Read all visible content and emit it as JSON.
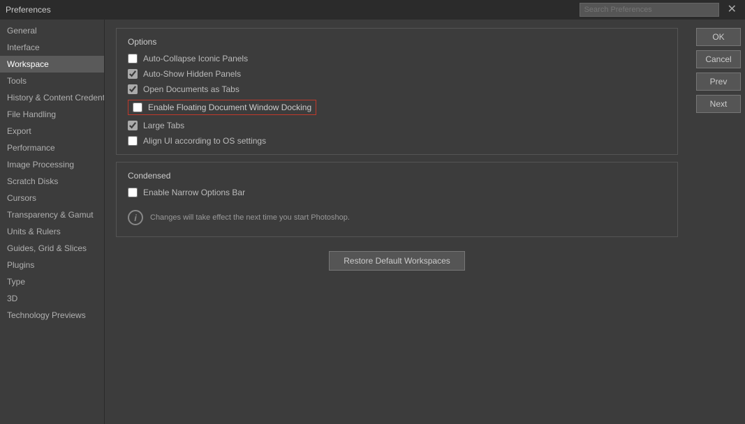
{
  "dialog": {
    "title": "Preferences"
  },
  "search": {
    "placeholder": "Search Preferences"
  },
  "sidebar": {
    "items": [
      {
        "id": "general",
        "label": "General",
        "active": false
      },
      {
        "id": "interface",
        "label": "Interface",
        "active": false
      },
      {
        "id": "workspace",
        "label": "Workspace",
        "active": true
      },
      {
        "id": "tools",
        "label": "Tools",
        "active": false
      },
      {
        "id": "history",
        "label": "History & Content Credentials",
        "active": false
      },
      {
        "id": "file-handling",
        "label": "File Handling",
        "active": false
      },
      {
        "id": "export",
        "label": "Export",
        "active": false
      },
      {
        "id": "performance",
        "label": "Performance",
        "active": false
      },
      {
        "id": "image-processing",
        "label": "Image Processing",
        "active": false
      },
      {
        "id": "scratch-disks",
        "label": "Scratch Disks",
        "active": false
      },
      {
        "id": "cursors",
        "label": "Cursors",
        "active": false
      },
      {
        "id": "transparency",
        "label": "Transparency & Gamut",
        "active": false
      },
      {
        "id": "units-rulers",
        "label": "Units & Rulers",
        "active": false
      },
      {
        "id": "guides",
        "label": "Guides, Grid & Slices",
        "active": false
      },
      {
        "id": "plugins",
        "label": "Plugins",
        "active": false
      },
      {
        "id": "type",
        "label": "Type",
        "active": false
      },
      {
        "id": "3d",
        "label": "3D",
        "active": false
      },
      {
        "id": "tech-previews",
        "label": "Technology Previews",
        "active": false
      }
    ]
  },
  "sections": {
    "options": {
      "title": "Options",
      "items": [
        {
          "id": "auto-collapse",
          "label": "Auto-Collapse Iconic Panels",
          "checked": false,
          "highlighted": false
        },
        {
          "id": "auto-show",
          "label": "Auto-Show Hidden Panels",
          "checked": true,
          "highlighted": false
        },
        {
          "id": "open-docs-tabs",
          "label": "Open Documents as Tabs",
          "checked": true,
          "highlighted": false
        },
        {
          "id": "floating-dock",
          "label": "Enable Floating Document Window Docking",
          "checked": false,
          "highlighted": true
        },
        {
          "id": "large-tabs",
          "label": "Large Tabs",
          "checked": true,
          "highlighted": false
        },
        {
          "id": "align-ui",
          "label": "Align UI according to OS settings",
          "checked": false,
          "highlighted": false
        }
      ]
    },
    "condensed": {
      "title": "Condensed",
      "items": [
        {
          "id": "narrow-options",
          "label": "Enable Narrow Options Bar",
          "checked": false
        }
      ]
    }
  },
  "info_message": "Changes will take effect the next time you start Photoshop.",
  "restore_button": "Restore Default Workspaces",
  "buttons": {
    "ok": "OK",
    "cancel": "Cancel",
    "prev": "Prev",
    "next": "Next"
  }
}
